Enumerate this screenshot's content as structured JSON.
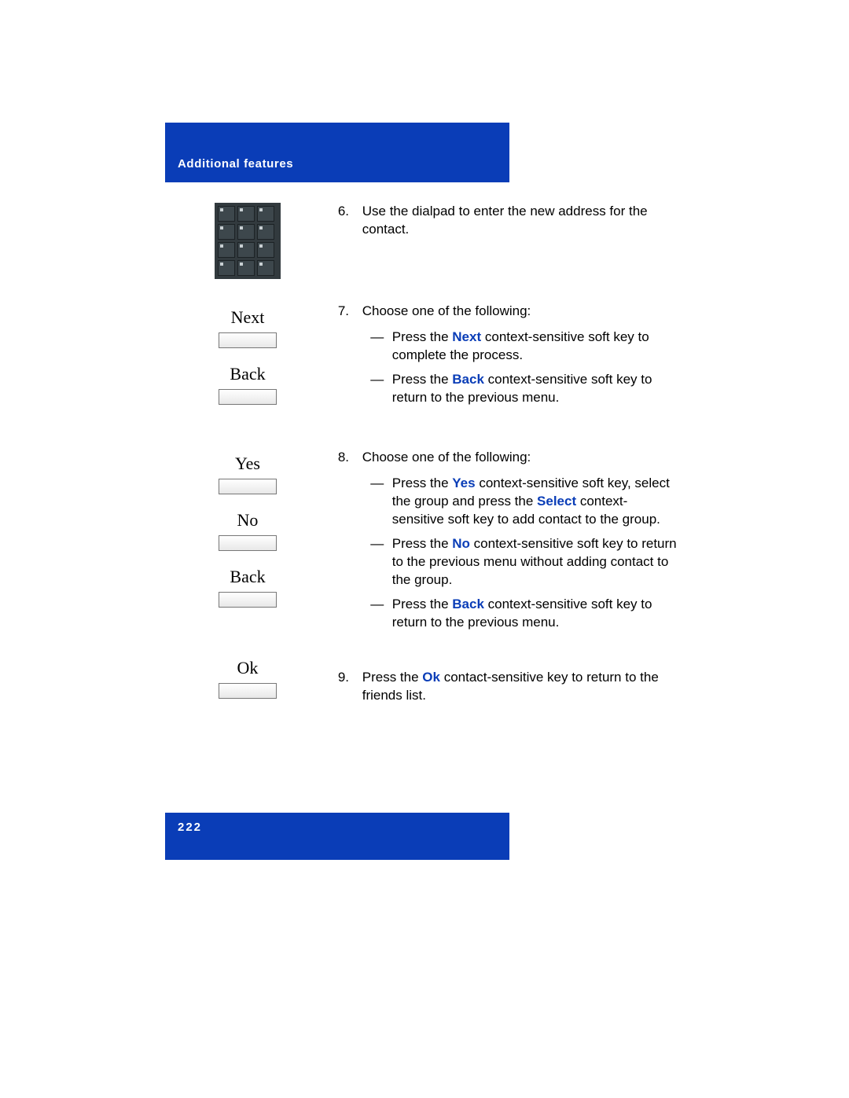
{
  "header": "Additional features",
  "page_number": "222",
  "softkeys": {
    "next": "Next",
    "back1": "Back",
    "yes": "Yes",
    "no": "No",
    "back2": "Back",
    "ok": "Ok"
  },
  "steps": {
    "s6": {
      "num": "6.",
      "text": "Use the dialpad to enter the new address for the contact."
    },
    "s7": {
      "num": "7.",
      "intro": "Choose one of the following:",
      "a_pre": "Press the ",
      "a_kw": "Next",
      "a_post": " context-sensitive soft key to complete the process.",
      "b_pre": "Press the ",
      "b_kw": "Back",
      "b_post": " context-sensitive soft key to return to the previous menu."
    },
    "s8": {
      "num": "8.",
      "intro": "Choose one of the following:",
      "a_pre": "Press the ",
      "a_kw": "Yes",
      "a_mid": " context-sensitive soft key, select the group and press the ",
      "a_kw2": "Select",
      "a_post": " context-sensitive soft key to add contact to the group.",
      "b_pre": "Press the ",
      "b_kw": "No",
      "b_post": " context-sensitive soft key to return to the previous menu without adding contact to the group.",
      "c_pre": "Press the ",
      "c_kw": "Back",
      "c_post": " context-sensitive soft key to return to the previous menu."
    },
    "s9": {
      "num": "9.",
      "pre": "Press the ",
      "kw": "Ok",
      "post": " contact-sensitive key to return to the friends list."
    }
  },
  "dash": "—"
}
